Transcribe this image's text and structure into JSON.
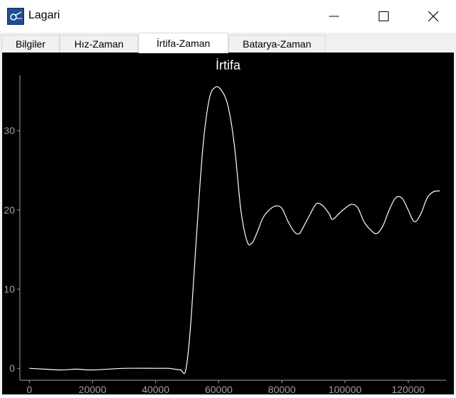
{
  "window": {
    "title": "Lagari",
    "icon": "app-logo-icon",
    "controls": [
      "minimize-icon",
      "maximize-icon",
      "close-icon"
    ]
  },
  "tabs": [
    {
      "label": "Bilgiler",
      "active": false
    },
    {
      "label": "Hız-Zaman",
      "active": false
    },
    {
      "label": "İrtifa-Zaman",
      "active": true
    },
    {
      "label": "Batarya-Zaman",
      "active": false
    }
  ],
  "colors": {
    "plot_background": "#000000",
    "line": "#ffffff",
    "axis_text": "#a0a0a0"
  },
  "chart_data": {
    "type": "line",
    "title": "İrtifa",
    "xlabel": "",
    "ylabel": "",
    "xlim": [
      -3000,
      132000
    ],
    "ylim": [
      -1.5,
      37
    ],
    "x_ticks": [
      0,
      20000,
      40000,
      60000,
      80000,
      100000,
      120000
    ],
    "y_ticks": [
      0,
      10,
      20,
      30
    ],
    "grid": false,
    "series": [
      {
        "x": [
          0,
          5000,
          10000,
          15000,
          20000,
          30000,
          40000,
          44000,
          46000,
          48000,
          49500,
          51000,
          53000,
          55000,
          57000,
          59000,
          61000,
          63000,
          65000,
          67000,
          69000,
          70500,
          72000,
          74000,
          76000,
          78000,
          80000,
          82000,
          84000,
          85500,
          87000,
          89000,
          91000,
          93000,
          95000,
          96000,
          98000,
          100000,
          102000,
          104000,
          106000,
          108000,
          110000,
          112000,
          114000,
          116000,
          118000,
          120000,
          122000,
          124000,
          126000,
          128000,
          130000
        ],
        "y": [
          0,
          -0.1,
          -0.2,
          -0.1,
          -0.2,
          0,
          0,
          0,
          -0.1,
          -0.2,
          -0.3,
          5,
          17,
          28,
          34,
          35.5,
          35,
          33,
          28,
          20,
          16,
          15.8,
          17,
          19,
          20,
          20.5,
          20.2,
          18.5,
          17.2,
          17,
          18,
          19.5,
          20.8,
          20.5,
          19.5,
          18.8,
          19.5,
          20.2,
          20.7,
          20.3,
          18.5,
          17.5,
          17,
          18,
          20,
          21.5,
          21.5,
          20,
          18.5,
          19.5,
          21.5,
          22.3,
          22.4
        ]
      }
    ]
  }
}
